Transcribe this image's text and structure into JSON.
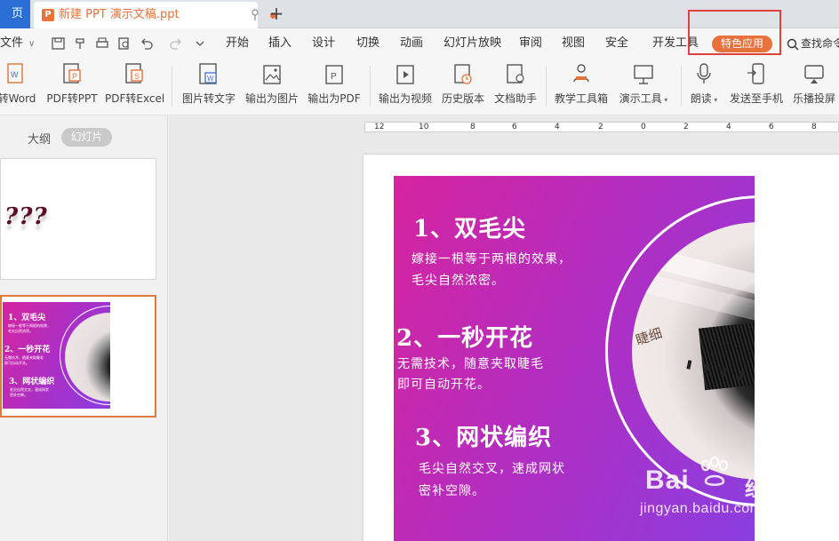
{
  "tabs": {
    "home_label": "页",
    "doc_title": "新建 PPT 演示文稿.ppt",
    "doc_icon_letter": "P",
    "new_tab": "+"
  },
  "menu": {
    "file_label": "文件",
    "items": [
      "开始",
      "插入",
      "设计",
      "切换",
      "动画",
      "幻灯片放映",
      "审阅",
      "视图",
      "安全",
      "开发工具"
    ],
    "special_label": "特色应用",
    "search_label": "查找命令"
  },
  "toolbar": {
    "tools": [
      {
        "label": "转Word",
        "icon": "pdf-to-word-icon"
      },
      {
        "label": "PDF转PPT",
        "icon": "pdf-to-ppt-icon"
      },
      {
        "label": "PDF转Excel",
        "icon": "pdf-to-excel-icon"
      },
      {
        "label": "图片转文字",
        "icon": "image-to-text-icon"
      },
      {
        "label": "输出为图片",
        "icon": "export-image-icon"
      },
      {
        "label": "输出为PDF",
        "icon": "export-pdf-icon"
      },
      {
        "label": "输出为视频",
        "icon": "export-video-icon"
      },
      {
        "label": "历史版本",
        "icon": "history-icon"
      },
      {
        "label": "文档助手",
        "icon": "doc-assistant-icon"
      },
      {
        "label": "教学工具箱",
        "icon": "teaching-tools-icon"
      },
      {
        "label": "演示工具",
        "icon": "presentation-tools-icon"
      },
      {
        "label": "朗读",
        "icon": "read-aloud-icon"
      },
      {
        "label": "发送至手机",
        "icon": "send-to-phone-icon"
      },
      {
        "label": "乐播投屏",
        "icon": "screen-cast-icon"
      }
    ]
  },
  "panel": {
    "outline_tab": "大纲",
    "slides_tab": "幻灯片",
    "thumb1_text": "???",
    "thumb2": {
      "h1": "1、双毛尖",
      "b1": "嫁接一根等于两根的效果，",
      "b1b": "毛尖自然浓密。",
      "h2": "2、一秒开花",
      "b2": "无需技术，随意夹取睫毛",
      "b2b": "即可自动开花。",
      "h3": "3、网状编织",
      "b3": "毛尖自然交叉，速成网状",
      "b3b": "密补空隙。"
    }
  },
  "ruler": {
    "ticks": [
      "12",
      "10",
      "8",
      "6",
      "4",
      "2",
      "0",
      "2",
      "4",
      "6",
      "8"
    ]
  },
  "slide": {
    "h1": "1、双毛尖",
    "b1_line1": "嫁接一根等于两根的效果，",
    "b1_line2": "毛尖自然浓密。",
    "h2": "2、一秒开花",
    "b2_line1": "无需技术，随意夹取睫毛",
    "b2_line2": "即可自动开花。",
    "h3": "3、网状编织",
    "b3_line1": "毛尖自然交叉，速成网状",
    "b3_line2": "密补空隙。",
    "photo_label": "睫细"
  },
  "watermark": {
    "brand_latin": "Bai",
    "brand_cn": "经验",
    "url": "jingyan.baidu.com"
  },
  "colors": {
    "accent": "#e8713c",
    "highlight_box": "#e0413a",
    "slide_gradient_start": "#d6249f",
    "slide_gradient_end": "#8a3ee0"
  }
}
